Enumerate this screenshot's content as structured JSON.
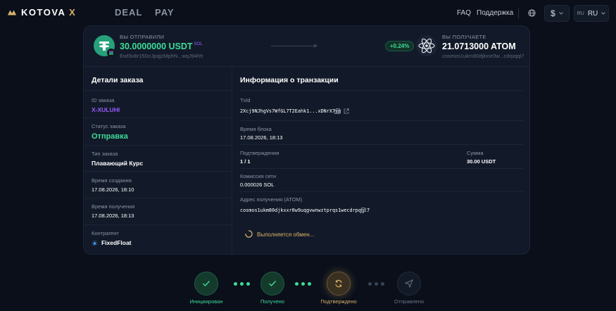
{
  "brand": {
    "name": "KOTOVA",
    "suffix": "X",
    "accent": "#d9b26a"
  },
  "nav": {
    "deal": "DEAL",
    "pay": "PAY",
    "faq": "FAQ",
    "support": "Поддержка",
    "currency": "$",
    "lang_code": "RU",
    "lang_label": "RU"
  },
  "hero": {
    "sent_label": "ВЫ ОТПРАВИЛИ",
    "sent_amount": "30.0000000 USDT",
    "sent_network": "SOL",
    "sent_address": "Ewf3v8r15DcJpqjzMphN...wqJ94hh",
    "rate_badge": "+0.24%",
    "recv_label": "ВЫ ПОЛУЧАЕТЕ",
    "recv_amount": "21.0713000 ATOM",
    "recv_address": "cosmos1ukm80djkxxr0w...cdrpqqt7"
  },
  "order": {
    "title": "Детали заказа",
    "id_label": "ID заказа",
    "id_value": "X-XULUHI",
    "status_label": "Статус заказа",
    "status_value": "Отправка",
    "type_label": "Тип заказа",
    "type_value": "Плавающий Курс",
    "created_label": "Время создания",
    "created_value": "17.08.2026, 18:10",
    "received_label": "Время получения",
    "received_value": "17.08.2026, 18:13",
    "counterparty_label": "Контрагент",
    "counterparty_value": "FixedFloat"
  },
  "tx": {
    "title": "Информация о транзакции",
    "txid_label": "TxId",
    "txid_value": "2Xcj9NJhgVs7WfGL7T2Eahk1...xDNrX7yg",
    "block_time_label": "Время блока",
    "block_time_value": "17.08.2026, 18:13",
    "confirm_label": "Подтверждения",
    "confirm_value": "1 / 1",
    "sum_label": "Сумма",
    "sum_value": "30.00 USDT",
    "fee_label": "Комиссия сети",
    "fee_value": "0.000026 SOL",
    "addr_label": "Адрес получения (ATOM)",
    "addr_value": "cosmos1ukm80djkxxr0w9uqgvwnwztprqs1wecdrpqqt7",
    "progress_text": "Выполняется обмен..."
  },
  "steps": [
    {
      "label": "Инициирован",
      "state": "done"
    },
    {
      "label": "Получено",
      "state": "done"
    },
    {
      "label": "Подтверждено",
      "state": "active"
    },
    {
      "label": "Отправлено",
      "state": "pending"
    }
  ],
  "colors": {
    "green": "#3ddc97",
    "purple": "#9b5cff",
    "gold": "#d9b26a",
    "usdt": "#26a17b"
  }
}
